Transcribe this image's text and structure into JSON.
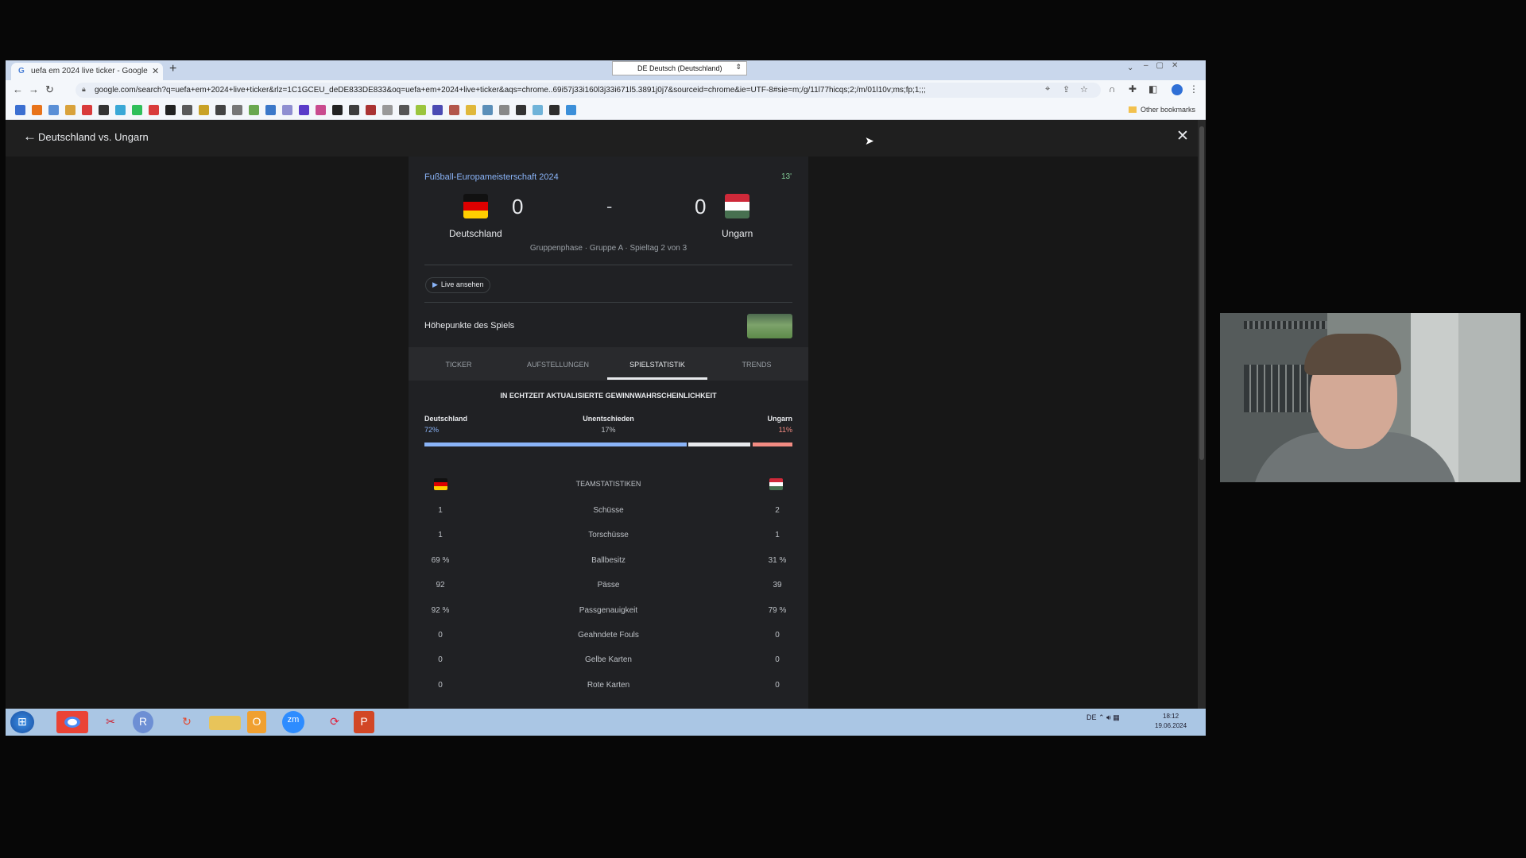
{
  "browser": {
    "tab_title": "uefa em 2024 live ticker - Google",
    "tab_close": "✕",
    "new_tab": "+",
    "language_select": "DE Deutsch (Deutschland)",
    "url": "google.com/search?q=uefa+em+2024+live+ticker&rlz=1C1GCEU_deDE833DE833&oq=uefa+em+2024+live+ticker&aqs=chrome..69i57j33i160l3j33i671l5.3891j0j7&sourceid=chrome&ie=UTF-8#sie=m;/g/11l77hicqs;2;/m/01l10v;ms;fp;1;;;",
    "other_bookmarks": "Other bookmarks"
  },
  "page": {
    "back_title": "Deutschland vs. Ungarn",
    "close": "✕"
  },
  "match": {
    "competition": "Fußball-Europameisterschaft 2024",
    "minute": "13'",
    "home_team": "Deutschland",
    "away_team": "Ungarn",
    "home_score": "0",
    "away_score": "0",
    "score_separator": "-",
    "phase": "Gruppenphase · Gruppe A · Spieltag 2 von 3",
    "watch_live": "Live ansehen",
    "highlights": "Höhepunkte des Spiels",
    "tabs": [
      "TICKER",
      "AUFSTELLUNGEN",
      "SPIELSTATISTIK",
      "TRENDS"
    ],
    "active_tab": "SPIELSTATISTIK"
  },
  "win_probability": {
    "heading": "IN ECHTZEIT AKTUALISIERTE GEWINNWAHRSCHEINLICHKEIT",
    "home_label": "Deutschland",
    "draw_label": "Unentschieden",
    "away_label": "Ungarn",
    "home_pct": "72%",
    "draw_pct": "17%",
    "away_pct": "11%",
    "home_value": 72,
    "draw_value": 17,
    "away_value": 11,
    "home_color": "#8ab4f8",
    "draw_color": "#e8eaed",
    "away_color": "#f28b82"
  },
  "team_stats": {
    "heading": "TEAMSTATISTIKEN",
    "rows": [
      {
        "label": "Schüsse",
        "home": "1",
        "away": "2"
      },
      {
        "label": "Torschüsse",
        "home": "1",
        "away": "1"
      },
      {
        "label": "Ballbesitz",
        "home": "69 %",
        "away": "31 %"
      },
      {
        "label": "Pässe",
        "home": "92",
        "away": "39"
      },
      {
        "label": "Passgenauigkeit",
        "home": "92 %",
        "away": "79 %"
      },
      {
        "label": "Geahndete Fouls",
        "home": "0",
        "away": "0"
      },
      {
        "label": "Gelbe Karten",
        "home": "0",
        "away": "0"
      },
      {
        "label": "Rote Karten",
        "home": "0",
        "away": "0"
      }
    ]
  },
  "taskbar": {
    "apps": [
      "windows-start",
      "chrome",
      "snipping-tool",
      "r-studio",
      "restore-tool",
      "file-explorer",
      "outlook",
      "zoom",
      "backup-tool",
      "powerpoint"
    ],
    "tray_lang": "DE",
    "time": "18:12",
    "date": "19.06.2024"
  }
}
